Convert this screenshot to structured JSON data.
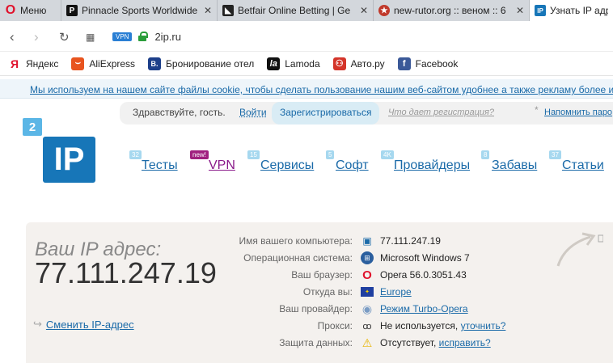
{
  "tabs": [
    {
      "title": "Меню"
    },
    {
      "title": "Pinnacle Sports Worldwide"
    },
    {
      "title": "Betfair Online Betting | Ge"
    },
    {
      "title": "new-rutor.org :: веном :: 6"
    },
    {
      "title": "Узнать IP адрес"
    }
  ],
  "address": {
    "vpn": "VPN",
    "url": "2ip.ru"
  },
  "bookmarks": [
    {
      "label": "Яндекс",
      "icon": "Я",
      "color": "#e0112b"
    },
    {
      "label": "AliExpress",
      "icon": "A",
      "color": "#e8541f"
    },
    {
      "label": "Бронирование отел",
      "icon": "B.",
      "color": "#1d3f8a"
    },
    {
      "label": "Lamoda",
      "icon": "la",
      "color": "#111111"
    },
    {
      "label": "Авто.ру",
      "icon": "A",
      "color": "#d4352a"
    },
    {
      "label": "Facebook",
      "icon": "f",
      "color": "#3b5998"
    }
  ],
  "cookie_notice": "Мы используем на нашем сайте файлы cookie, чтобы сделать пользование нашим веб-сайтом удобнее а также рекламу более и",
  "login": {
    "greet": "Здравствуйте, гость.",
    "login": "Войти",
    "register": "Зарегистрироваться",
    "what": "Что дает регистрация?",
    "remind": "Напомнить паро"
  },
  "logo": {
    "small": "2",
    "big": "IP"
  },
  "nav": [
    {
      "label": "Тесты",
      "badge": "32"
    },
    {
      "label": "VPN",
      "badge": "new!"
    },
    {
      "label": "Сервисы",
      "badge": "15"
    },
    {
      "label": "Софт",
      "badge": "5"
    },
    {
      "label": "Провайдеры",
      "badge": "4K"
    },
    {
      "label": "Забавы",
      "badge": "8"
    },
    {
      "label": "Статьи",
      "badge": "37"
    }
  ],
  "ip_panel": {
    "label": "Ваш IP адрес:",
    "ip": "77.111.247.19",
    "change": "Сменить IP-адрес"
  },
  "details": [
    {
      "key": "Имя вашего компьютера:",
      "value": "77.111.247.19",
      "icon": "computer-icon"
    },
    {
      "key": "Операционная система:",
      "value": "Microsoft Windows 7",
      "icon": "windows-icon"
    },
    {
      "key": "Ваш браузер:",
      "value": "Opera 56.0.3051.43",
      "icon": "opera-icon"
    },
    {
      "key": "Откуда вы:",
      "value": "Europe",
      "icon": "eu-flag-icon"
    },
    {
      "key": "Ваш провайдер:",
      "value": "Режим Turbo-Opera",
      "icon": "provider-icon"
    },
    {
      "key": "Прокси:",
      "value": "Не используется,",
      "link": "уточнить?",
      "icon": "glasses-icon"
    },
    {
      "key": "Защита данных:",
      "value": "Отсутствует,",
      "link": "исправить?",
      "icon": "warning-icon"
    }
  ]
}
